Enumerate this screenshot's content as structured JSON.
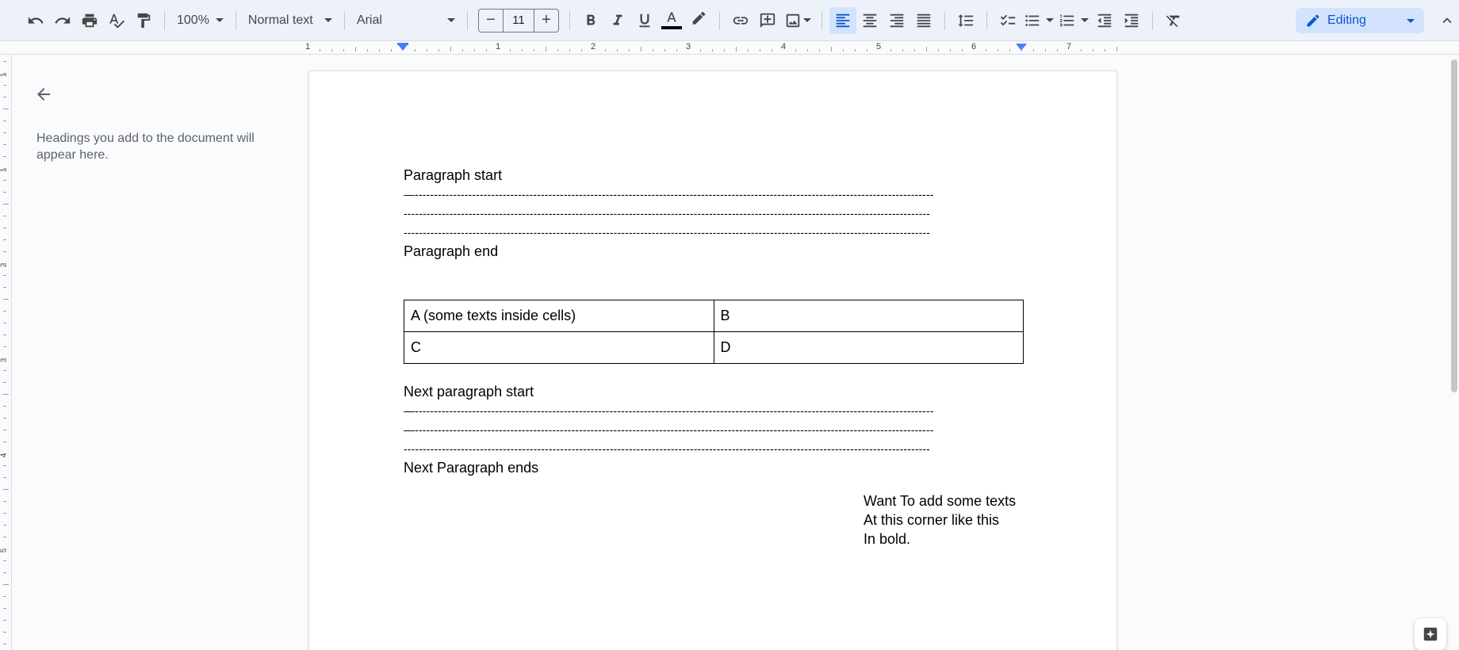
{
  "toolbar": {
    "zoom": "100%",
    "paragraph_style": "Normal text",
    "font_family": "Arial",
    "font_size": "11",
    "mode": "Editing"
  },
  "ruler": {
    "horizontal_numbers": [
      "1",
      "1",
      "2",
      "3",
      "4",
      "5",
      "6",
      "7"
    ],
    "vertical_numbers": [
      "1",
      "1",
      "2",
      "3",
      "4",
      "5"
    ]
  },
  "outline": {
    "message": "Headings you add to the document will appear here."
  },
  "document": {
    "para1_start": "Paragraph start",
    "para1_lines": [
      "—----------------------------------------------------------------------------------------------------------------------------------------",
      "------------------------------------------------------------------------------------------------------------------------------------------",
      "------------------------------------------------------------------------------------------------------------------------------------------"
    ],
    "para1_end": "Paragraph end",
    "table": [
      [
        "A (some texts inside cells)",
        "B"
      ],
      [
        "C",
        "D"
      ]
    ],
    "para2_start": "Next paragraph start",
    "para2_lines": [
      "—----------------------------------------------------------------------------------------------------------------------------------------",
      "—----------------------------------------------------------------------------------------------------------------------------------------",
      "------------------------------------------------------------------------------------------------------------------------------------------"
    ],
    "para2_end": "Next Paragraph ends",
    "corner_lines": [
      "Want To add some texts",
      "At this corner like this",
      "In bold."
    ]
  }
}
